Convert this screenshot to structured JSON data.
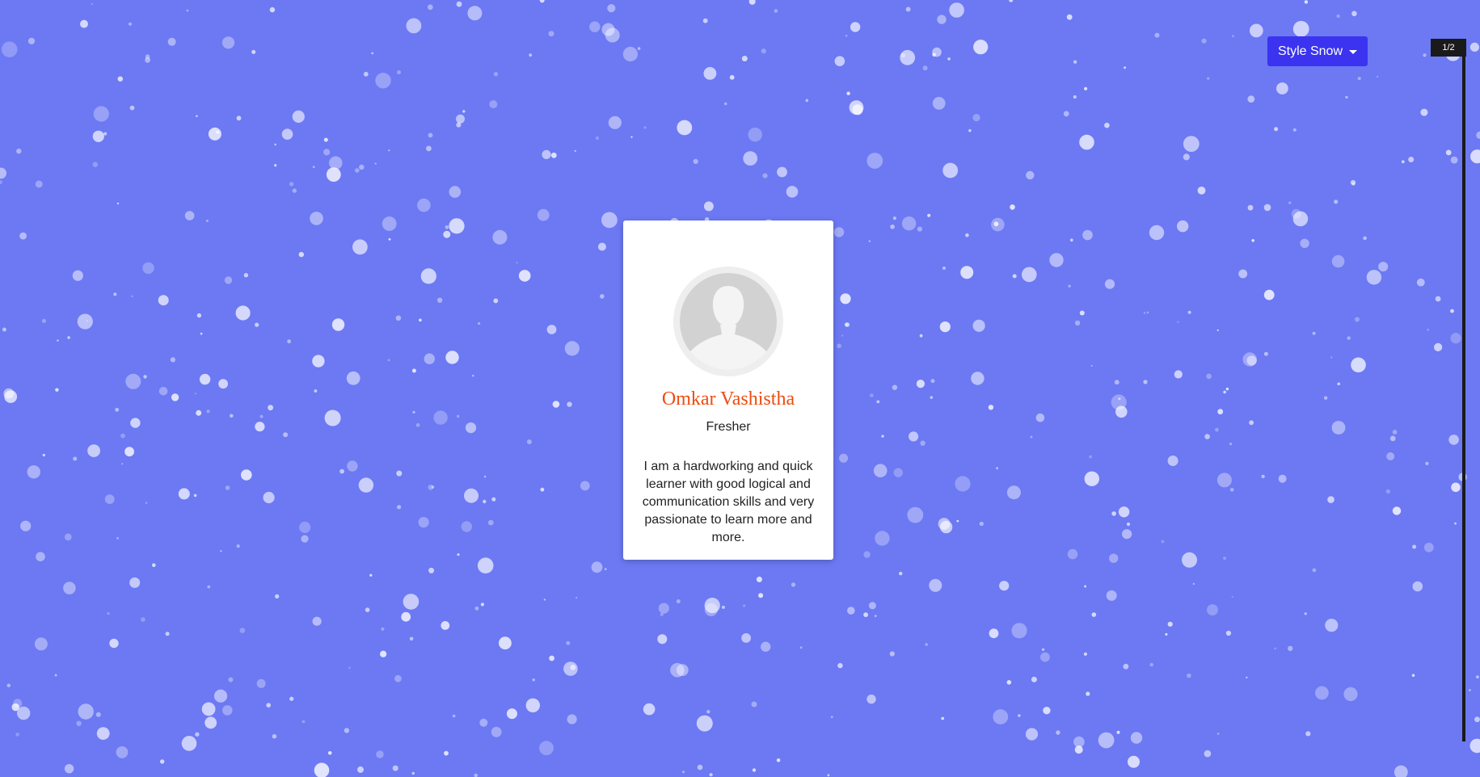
{
  "style_dropdown": {
    "label": "Style Snow"
  },
  "pager": {
    "label": "1/2"
  },
  "profile_card": {
    "name": "Omkar Vashistha",
    "role": "Fresher",
    "bio": "I am a hardworking and quick learner with good logical and communication skills and very passionate to learn more and more."
  },
  "icons": {
    "avatar": "person-placeholder-icon",
    "dropdown_caret": "caret-down-icon"
  },
  "colors": {
    "background": "#6c79f3",
    "dropdown": "#3b33f0",
    "name_accent": "#ee4b0f",
    "snow": "#ffffff"
  }
}
